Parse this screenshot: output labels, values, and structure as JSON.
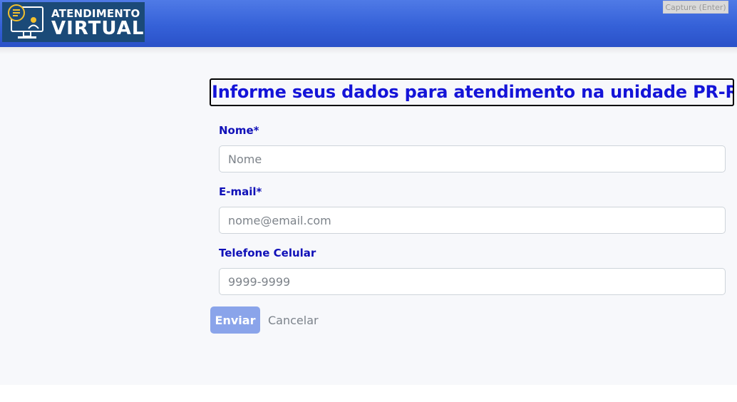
{
  "header": {
    "logo_line1": "ATENDIMENTO",
    "logo_line2": "VIRTUAL",
    "capture_label": "Capture (Enter)"
  },
  "form": {
    "title": "Informe seus dados para atendimento na unidade PR-RS",
    "name_label": "Nome*",
    "name_placeholder": "Nome",
    "email_label": "E-mail*",
    "email_placeholder": "nome@email.com",
    "phone_label": "Telefone Celular",
    "phone_placeholder": "9999-9999",
    "submit_label": "Enviar",
    "cancel_label": "Cancelar"
  },
  "colors": {
    "header_blue": "#3561d8",
    "title_blue": "#1414d8",
    "label_blue": "#1010b8",
    "submit_button": "#8aa4ea"
  }
}
